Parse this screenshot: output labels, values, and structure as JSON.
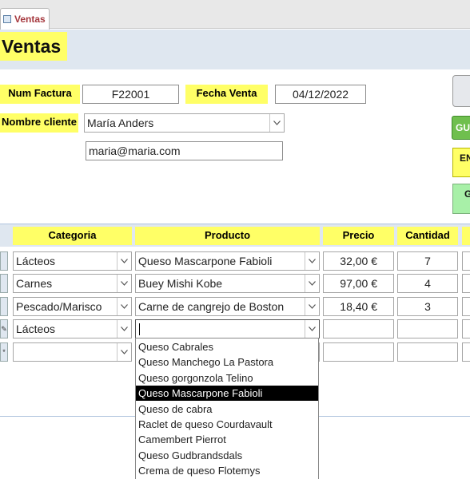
{
  "tab": {
    "label": "Ventas"
  },
  "form": {
    "title": "Ventas"
  },
  "fields": {
    "num_factura": {
      "label": "Num Factura",
      "value": "F22001"
    },
    "fecha_venta": {
      "label": "Fecha Venta",
      "value": "04/12/2022"
    },
    "nombre_cliente": {
      "label": "Nombre cliente",
      "value": "María Anders"
    },
    "email": {
      "value": "maria@maria.com"
    }
  },
  "buttons": {
    "guardar_partial": "GU",
    "enviar_partial": "EN",
    "g_partial": "G"
  },
  "grid": {
    "columns": [
      "Categoria",
      "Producto",
      "Precio",
      "Cantidad"
    ],
    "rows": [
      {
        "categoria": "Lácteos",
        "producto": "Queso Mascarpone Fabioli",
        "precio": "32,00 €",
        "cantidad": "7"
      },
      {
        "categoria": "Carnes",
        "producto": "Buey Mishi Kobe",
        "precio": "97,00 €",
        "cantidad": "4"
      },
      {
        "categoria": "Pescado/Marisco",
        "producto": "Carne de cangrejo de Boston",
        "precio": "18,40 €",
        "cantidad": "3"
      },
      {
        "categoria": "Lácteos",
        "producto": "",
        "precio": "",
        "cantidad": ""
      },
      {
        "categoria": "",
        "producto": "",
        "precio": "",
        "cantidad": ""
      }
    ],
    "record_selectors": [
      "",
      "",
      "",
      "✎",
      "*"
    ]
  },
  "dropdown": {
    "options": [
      "Queso Cabrales",
      "Queso Manchego La Pastora",
      "Queso gorgonzola Telino",
      "Queso Mascarpone Fabioli",
      "Queso de cabra",
      "Raclet de queso Courdavault",
      "Camembert Pierrot",
      "Queso Gudbrandsdals",
      "Crema de queso Flotemys"
    ],
    "highlighted": "Queso Mascarpone Fabioli"
  },
  "colors": {
    "label_bg": "#ffff66",
    "header_bg": "#dfe7f0",
    "tab_text": "#a5373d",
    "highlight": "#000000"
  },
  "icons": {
    "tab": "form-icon",
    "combo": "chevron-down-icon"
  }
}
